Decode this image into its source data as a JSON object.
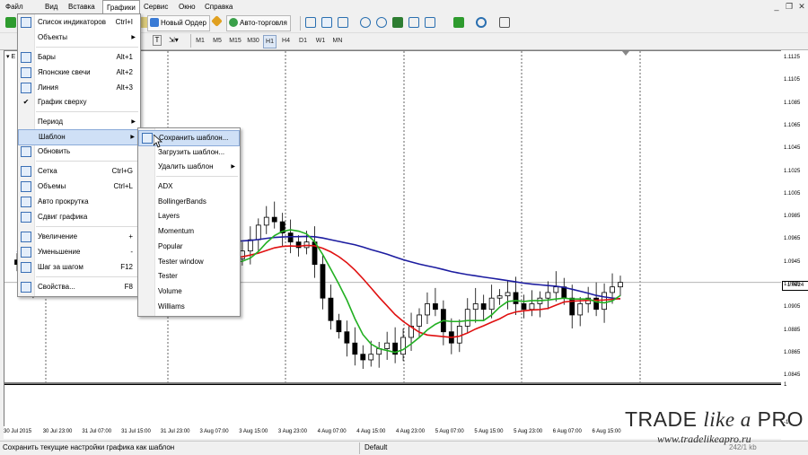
{
  "menubar": {
    "items": [
      "Файл",
      "Вид",
      "Вставка",
      "Графики",
      "Сервис",
      "Окно",
      "Справка"
    ],
    "active": "Графики"
  },
  "toolbar": {
    "new_order": "Новый Ордер",
    "autotrading": "Авто-торговля",
    "timeframes": [
      "M1",
      "M5",
      "M15",
      "M30",
      "H1",
      "H4",
      "D1",
      "W1",
      "MN"
    ],
    "selected_timeframe": "H1",
    "chart_symbol_fragment": "E"
  },
  "charts_menu": {
    "items": [
      {
        "label": "Список индикаторов",
        "shortcut": "Ctrl+I",
        "icon": "indicator-list-icon"
      },
      {
        "label": "Объекты",
        "arrow": true,
        "icon": ""
      },
      {
        "label": "Бары",
        "shortcut": "Alt+1",
        "icon": "bar-chart-icon"
      },
      {
        "label": "Японские свечи",
        "shortcut": "Alt+2",
        "icon": "candlestick-icon"
      },
      {
        "label": "Линия",
        "shortcut": "Alt+3",
        "icon": "line-chart-icon"
      },
      {
        "label": "График сверху",
        "icon": "check-icon"
      },
      {
        "label": "Период",
        "arrow": true,
        "icon": ""
      },
      {
        "label": "Шаблон",
        "arrow": true,
        "icon": ""
      },
      {
        "label": "Обновить",
        "icon": "refresh-icon"
      },
      {
        "label": "Сетка",
        "shortcut": "Ctrl+G",
        "icon": "grid-icon"
      },
      {
        "label": "Объемы",
        "shortcut": "Ctrl+L",
        "icon": "volumes-icon"
      },
      {
        "label": "Авто прокрутка",
        "icon": "autoscroll-icon"
      },
      {
        "label": "Сдвиг графика",
        "icon": "chart-shift-icon"
      },
      {
        "label": "Увеличение",
        "shortcut": "+",
        "icon": "zoom-in-icon"
      },
      {
        "label": "Уменьшение",
        "shortcut": "-",
        "icon": "zoom-out-icon"
      },
      {
        "label": "Шаг за шагом",
        "shortcut": "F12",
        "icon": "step-icon"
      },
      {
        "label": "Свойства...",
        "shortcut": "F8",
        "icon": "properties-icon"
      }
    ]
  },
  "template_menu": {
    "items": [
      "Сохранить шаблон...",
      "Загрузить шаблон...",
      "Удалить шаблон"
    ],
    "templates": [
      "ADX",
      "BollingerBands",
      "Layers",
      "Momentum",
      "Popular",
      "Tester window",
      "Tester",
      "Volume",
      "Williams"
    ]
  },
  "price_axis": {
    "labels": [
      "1.1125",
      "1.1105",
      "1.1085",
      "1.1065",
      "1.1045",
      "1.1025",
      "1.1005",
      "1.0985",
      "1.0965",
      "1.0945",
      "1.0925",
      "1.0905",
      "1.0885",
      "1.0865",
      "1.0845"
    ],
    "current_price": "1.0924",
    "sub_top": "1",
    "sub_bottom": "-1"
  },
  "time_axis": {
    "labels": [
      "30 Jul 2015",
      "30 Jul 23:00",
      "31 Jul 07:00",
      "31 Jul 15:00",
      "31 Jul 23:00",
      "3 Aug 07:00",
      "3 Aug 15:00",
      "3 Aug 23:00",
      "4 Aug 07:00",
      "4 Aug 15:00",
      "4 Aug 23:00",
      "5 Aug 07:00",
      "5 Aug 15:00",
      "5 Aug 23:00",
      "6 Aug 07:00",
      "6 Aug 15:00"
    ]
  },
  "statusbar": {
    "hint": "Сохранить текущие настройки графика как шаблон",
    "profile": "Default",
    "traffic": "242/1 kb"
  },
  "watermark": {
    "brand_a": "TRADE ",
    "brand_b": "like a",
    "brand_c": " PRO",
    "url": "www.tradelikeapro.ru"
  },
  "colors": {
    "ma_slow": "#1c1ca0",
    "ma_mid": "#e01010",
    "ma_fast": "#22b022",
    "menu_highlight": "#cfe0f6"
  },
  "chart_data": {
    "type": "candlestick",
    "ylim": [
      1.0835,
      1.113
    ],
    "series_names": [],
    "candles_close": [
      1.094,
      1.093,
      1.092,
      1.0935,
      1.095,
      1.0945,
      1.0955,
      1.096,
      1.097,
      1.0965,
      1.0972,
      1.0968,
      1.096,
      1.095,
      1.0945,
      1.094,
      1.0952,
      1.0948,
      1.0945,
      1.095,
      1.0955,
      1.0958,
      1.095,
      1.0945,
      1.094,
      1.0935,
      1.094,
      1.0945,
      1.0952,
      1.0962,
      1.0975,
      1.0982,
      1.0978,
      1.0968,
      1.096,
      1.0955,
      1.096,
      1.094,
      1.091,
      1.089,
      1.088,
      1.087,
      1.086,
      1.0855,
      1.086,
      1.0865,
      1.087,
      1.086,
      1.0875,
      1.0885,
      1.0895,
      1.0905,
      1.09,
      1.088,
      1.087,
      1.0885,
      1.09,
      1.0905,
      1.09,
      1.091,
      1.0912,
      1.0915,
      1.0905,
      1.09,
      1.0905,
      1.091,
      1.0915,
      1.092,
      1.091,
      1.0895,
      1.0905,
      1.091,
      1.09,
      1.0915,
      1.092,
      1.0924
    ]
  }
}
